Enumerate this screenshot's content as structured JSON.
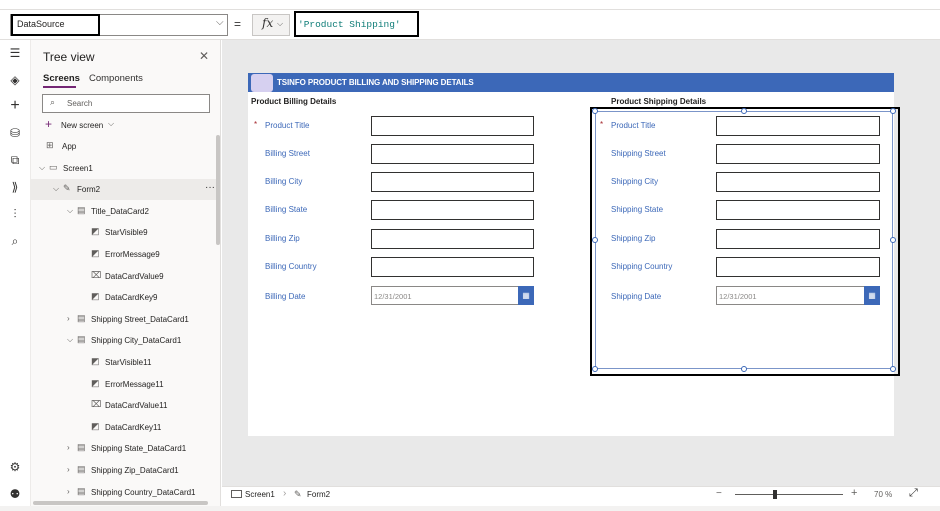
{
  "formula_bar": {
    "property": "DataSource",
    "equals": "=",
    "fx_label": "fx",
    "formula": "'Product Shipping'"
  },
  "tree_view": {
    "title": "Tree view",
    "tabs": [
      "Screens",
      "Components"
    ],
    "search_placeholder": "Search",
    "new_screen": "New screen",
    "items": [
      {
        "label": "App",
        "icon": "app-icon",
        "expanded": null
      },
      {
        "label": "Screen1",
        "icon": "screen-icon",
        "expanded": true
      },
      {
        "label": "Form2",
        "icon": "form-icon",
        "expanded": true,
        "selected": true
      },
      {
        "label": "Title_DataCard2",
        "icon": "card-icon",
        "expanded": true
      },
      {
        "label": "StarVisible9",
        "icon": "label-icon"
      },
      {
        "label": "ErrorMessage9",
        "icon": "label-icon"
      },
      {
        "label": "DataCardValue9",
        "icon": "text-input-icon"
      },
      {
        "label": "DataCardKey9",
        "icon": "label-icon"
      },
      {
        "label": "Shipping Street_DataCard1",
        "icon": "card-icon",
        "expanded": false
      },
      {
        "label": "Shipping City_DataCard1",
        "icon": "card-icon",
        "expanded": true
      },
      {
        "label": "StarVisible11",
        "icon": "label-icon"
      },
      {
        "label": "ErrorMessage11",
        "icon": "label-icon"
      },
      {
        "label": "DataCardValue11",
        "icon": "text-input-icon"
      },
      {
        "label": "DataCardKey11",
        "icon": "label-icon"
      },
      {
        "label": "Shipping State_DataCard1",
        "icon": "card-icon",
        "expanded": false
      },
      {
        "label": "Shipping Zip_DataCard1",
        "icon": "card-icon",
        "expanded": false
      },
      {
        "label": "Shipping Country_DataCard1",
        "icon": "card-icon",
        "expanded": false
      }
    ]
  },
  "app": {
    "banner_title": "TSINFO PRODUCT BILLING AND SHIPPING DETAILS",
    "billing": {
      "section_title": "Product Billing Details",
      "fields": [
        "Product Title",
        "Billing Street",
        "Billing City",
        "Billing State",
        "Billing Zip",
        "Billing Country"
      ],
      "date_label": "Billing Date",
      "date_value": "12/31/2001"
    },
    "shipping": {
      "section_title": "Product Shipping Details",
      "fields": [
        "Product Title",
        "Shipping Street",
        "Shipping City",
        "Shipping State",
        "Shipping Zip",
        "Shipping Country"
      ],
      "date_label": "Shipping Date",
      "date_value": "12/31/2001"
    },
    "required_mark": "*"
  },
  "status_bar": {
    "screen_crumb": "Screen1",
    "form_crumb": "Form2",
    "zoom": "70 %"
  },
  "colors": {
    "accent": "#742774",
    "banner": "#3c68b8",
    "label": "#3c68b8"
  }
}
